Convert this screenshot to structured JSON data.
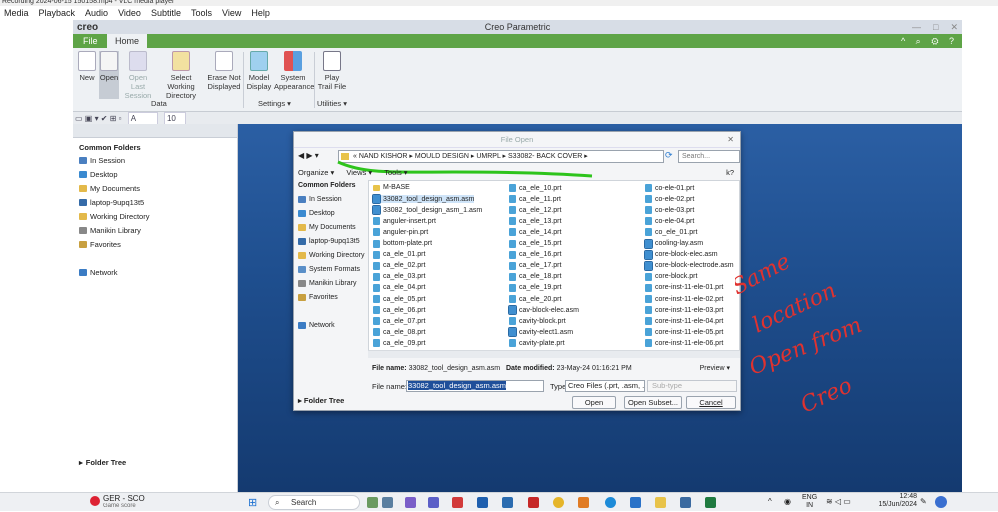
{
  "vlc": {
    "title": "Recording 2024-06-15 150158.mp4 - VLC media player",
    "menu": [
      "Media",
      "Playback",
      "Audio",
      "Video",
      "Subtitle",
      "Tools",
      "View",
      "Help"
    ]
  },
  "creo": {
    "title": "Creo Parametric",
    "logo": "creo",
    "tabs": {
      "file": "File",
      "home": "Home"
    },
    "ribbon": {
      "new": "New",
      "open": "Open",
      "open_last": "Open Last Session",
      "select_wd": "Select Working Directory",
      "erase": "Erase Not Displayed",
      "model_display": "Model Display",
      "system_appearance": "System Appearance",
      "play_trail": "Play Trail File",
      "group_data": "Data",
      "group_settings": "Settings ▾",
      "group_utilities": "Utilities ▾"
    },
    "qa": {
      "font": "A",
      "size": "10"
    },
    "left_panel": {
      "header": "Common Folders",
      "items": [
        "In Session",
        "Desktop",
        "My Documents",
        "laptop-9upq13t5",
        "Working Directory",
        "Manikin Library",
        "Favorites"
      ],
      "network": "Network",
      "folder_tree": "Folder Tree"
    }
  },
  "dialog": {
    "title": "File Open",
    "path": [
      "NAND KISHOR",
      "MOULD DESIGN",
      "UMRPL",
      "S33082- BACK COVER"
    ],
    "search_placeholder": "Search...",
    "organize": "Organize ▾",
    "views": "Views ▾",
    "tools": "Tools ▾",
    "common_header": "Common Folders",
    "common_items": [
      "In Session",
      "Desktop",
      "My Documents",
      "laptop-9upq13t5",
      "Working Directory",
      "System Formats",
      "Manikin Library",
      "Favorites"
    ],
    "network": "Network",
    "col1": [
      "M-BASE",
      "33082_tool_design_asm.asm",
      "33082_tool_design_asm_1.asm",
      "anguler-insert.prt",
      "anguler-pin.prt",
      "bottom-plate.prt",
      "ca_ele_01.prt",
      "ca_ele_02.prt",
      "ca_ele_03.prt",
      "ca_ele_04.prt",
      "ca_ele_05.prt",
      "ca_ele_06.prt",
      "ca_ele_07.prt",
      "ca_ele_08.prt",
      "ca_ele_09.prt"
    ],
    "col2": [
      "ca_ele_10.prt",
      "ca_ele_11.prt",
      "ca_ele_12.prt",
      "ca_ele_13.prt",
      "ca_ele_14.prt",
      "ca_ele_15.prt",
      "ca_ele_16.prt",
      "ca_ele_17.prt",
      "ca_ele_18.prt",
      "ca_ele_19.prt",
      "ca_ele_20.prt",
      "cav-block-elec.asm",
      "cavity-block.prt",
      "cavity-elect1.asm",
      "cavity-plate.prt"
    ],
    "col3": [
      "co-ele-01.prt",
      "co-ele-02.prt",
      "co-ele-03.prt",
      "co-ele-04.prt",
      "co_ele_01.prt",
      "cooling-lay.asm",
      "core-block-elec.asm",
      "core-block-electrode.asm",
      "core-block.prt",
      "core-inst-11-ele-01.prt",
      "core-inst-11-ele-02.prt",
      "core-inst-11-ele-03.prt",
      "core-inst-11-ele-04.prt",
      "core-inst-11-ele-05.prt",
      "core-inst-11-ele-06.prt"
    ],
    "info_label": "File name:",
    "info_value": "33082_tool_design_asm.asm",
    "date_label": "Date modified:",
    "date_value": "23-May-24 01:16:21 PM",
    "preview": "Preview ▾",
    "fname_label": "File name:",
    "fname_value": "33082_tool_design_asm.asm",
    "type_label": "Type",
    "type_value": "Creo Files (.prt, .asm, .d",
    "subtype": "Sub-type",
    "folder_tree": "Folder Tree",
    "btn_open": "Open",
    "btn_open_subset": "Open Subset...",
    "btn_cancel": "Cancel"
  },
  "annotation": [
    "Same",
    "location",
    "Open from",
    "Creo"
  ],
  "taskbar": {
    "weather": "GER - SCO",
    "weather_sub": "Game score",
    "search": "Search",
    "lang": "ENG",
    "lang_sub": "IN",
    "time": "12:48",
    "date": "15/Jun/2024"
  },
  "colors": {
    "ribbon_green": "#5ea447",
    "viewport": "#1f4f8f",
    "annotation_red": "#e0322f",
    "highlight_green": "#2ec41c"
  }
}
